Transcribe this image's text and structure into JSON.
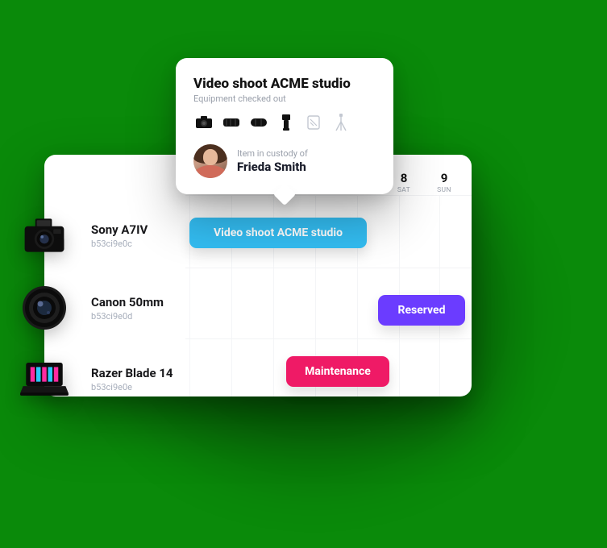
{
  "calendar": {
    "days": [
      {
        "num": "8",
        "dow": "SAT"
      },
      {
        "num": "9",
        "dow": "SUN"
      }
    ]
  },
  "items": [
    {
      "name": "Sony A7IV",
      "id": "b53ci9e0c",
      "thumb": "camera"
    },
    {
      "name": "Canon 50mm",
      "id": "b53ci9e0d",
      "thumb": "lens"
    },
    {
      "name": "Razer Blade 14",
      "id": "b53ci9e0e",
      "thumb": "laptop"
    }
  ],
  "events": {
    "shoot": "Video shoot ACME studio",
    "reserved": "Reserved",
    "maintenance": "Maintenance"
  },
  "popover": {
    "title": "Video shoot ACME studio",
    "subtitle": "Equipment checked out",
    "equipment_icons": [
      "camera",
      "lens",
      "lens2",
      "flash",
      "memory",
      "tripod"
    ],
    "custody_label": "Item in custody of",
    "custody_name": "Frieda Smith"
  },
  "colors": {
    "blue": "#33bdf2",
    "purple": "#6b3cff",
    "pink": "#ef1a66"
  }
}
